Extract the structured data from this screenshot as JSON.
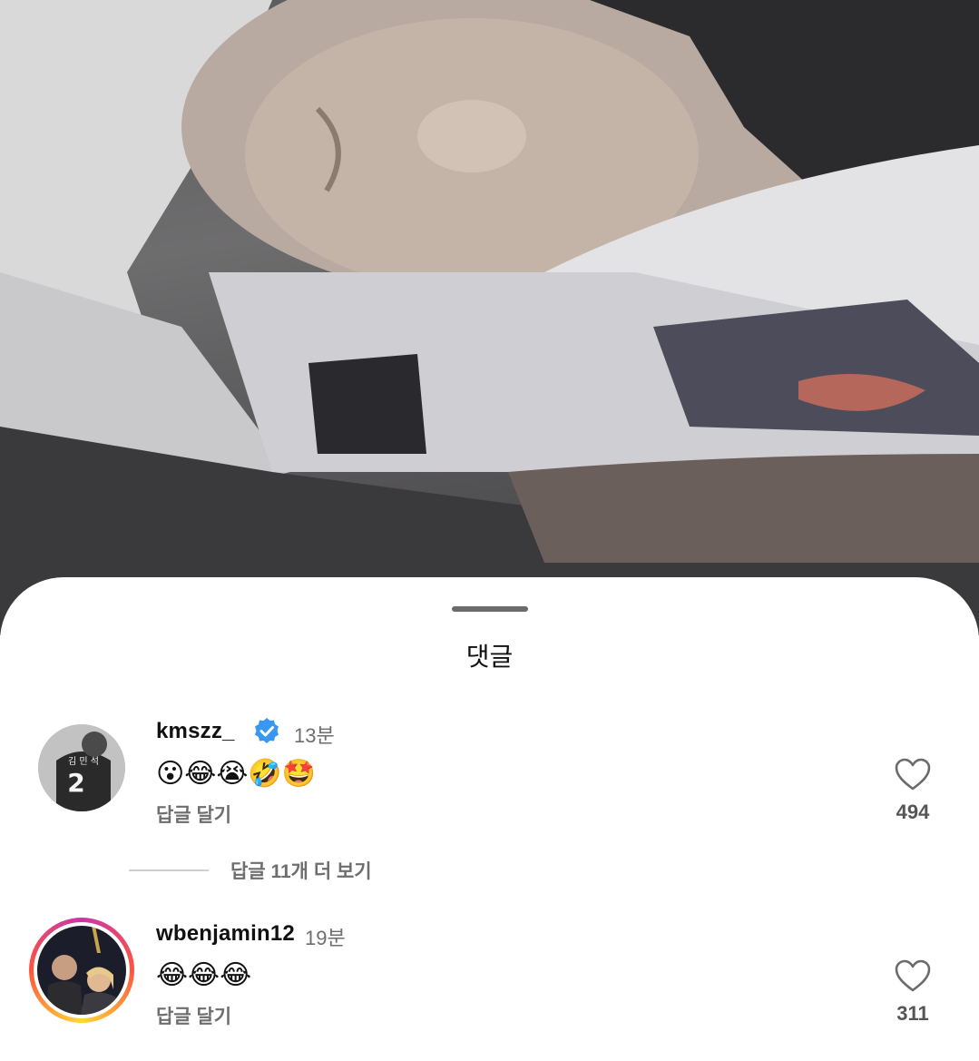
{
  "photo": {
    "description_icon": "photo-background"
  },
  "sheet": {
    "title": "댓글"
  },
  "comments": [
    {
      "username": "kmszz_",
      "verified": true,
      "time": "13분",
      "text": "😮😂😭🤣🤩",
      "reply_label": "답글 달기",
      "likes": "494",
      "avatar_jersey_name": "김 민 석",
      "avatar_jersey_number": "2"
    },
    {
      "username": "wbenjamin12",
      "verified": false,
      "time": "19분",
      "text": "😂😂😂",
      "reply_label": "답글 달기",
      "likes": "311"
    }
  ],
  "view_more_replies": "답글 11개 더 보기",
  "colors": {
    "accent_verified": "#3897f0",
    "muted": "#6e6e6e"
  }
}
